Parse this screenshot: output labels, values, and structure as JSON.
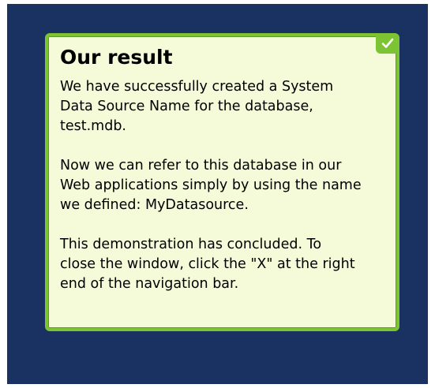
{
  "callout": {
    "title": "Our result",
    "check_icon": "checkmark-icon",
    "paragraphs": [
      {
        "lines": [
          "We have successfully created a System",
          "Data Source Name for the database,",
          "test.mdb."
        ]
      },
      {
        "lines": [
          "Now we can refer to this database in our",
          "Web applications simply by using the name",
          "we defined: MyDatasource."
        ]
      },
      {
        "lines": [
          "This demonstration has concluded. To",
          "close the window, click the \"X\" at the right",
          "end of the navigation bar."
        ]
      }
    ]
  },
  "colors": {
    "background": "#1a3262",
    "callout_fill": "#f5fad9",
    "callout_border": "#7cc431"
  }
}
